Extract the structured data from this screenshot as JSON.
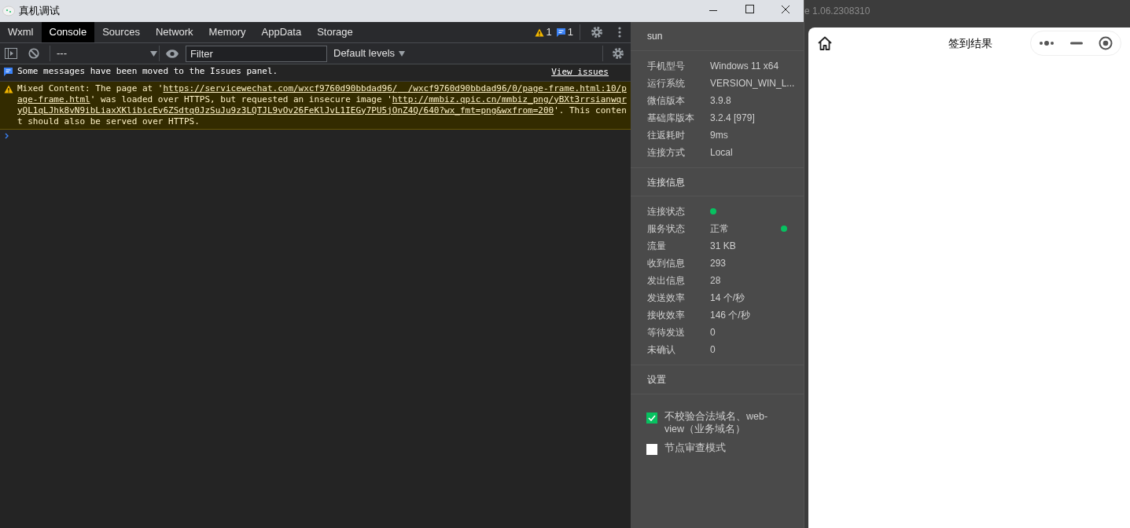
{
  "window": {
    "title": "真机调试"
  },
  "tabs": [
    {
      "label": "Wxml",
      "selected": false
    },
    {
      "label": "Console",
      "selected": true
    },
    {
      "label": "Sources",
      "selected": false
    },
    {
      "label": "Network",
      "selected": false
    },
    {
      "label": "Memory",
      "selected": false
    },
    {
      "label": "AppData",
      "selected": false
    },
    {
      "label": "Storage",
      "selected": false
    }
  ],
  "issue_counts": {
    "warnings": "1",
    "messages": "1"
  },
  "toolbar": {
    "context": "---",
    "filter_placeholder": "Filter",
    "levels": "Default levels"
  },
  "console": {
    "messages": [
      {
        "kind": "info",
        "parts": [
          {
            "text": "Some messages have been moved to the Issues panel.",
            "link": false
          }
        ],
        "action": "View issues"
      },
      {
        "kind": "warning",
        "parts": [
          {
            "text": "Mixed Content: The page at '",
            "link": false
          },
          {
            "text": "https://servicewechat.com/wxcf9760d90bbdad96/",
            "link": true
          },
          {
            "text": "  /wxcf9760d90bbdad96/0/page-frame.html:10/page-frame.html",
            "link": true
          },
          {
            "text": "' was loaded over HTTPS, but requested an insecure image '",
            "link": false
          },
          {
            "text": "http://mmbiz.qpic.cn/mmbiz_png/yBXt3rrsianwqryQL1qLJhk8vN9ibLiaxXKlibicEv6ZSdtq0JzSuJu9z3LQTJL9vOv26FeKlJvL1IEGy7PU5jOnZ4Q/640?wx_fmt=png&wxfrom=200",
            "link": true
          },
          {
            "text": "'. This content should also be served over HTTPS.",
            "link": false
          }
        ]
      }
    ]
  },
  "device_panel": {
    "user": "sun",
    "info": [
      {
        "label": "手机型号",
        "value": "Windows 11 x64"
      },
      {
        "label": "运行系统",
        "value": "VERSION_WIN_L..."
      },
      {
        "label": "微信版本",
        "value": "3.9.8"
      },
      {
        "label": "基础库版本",
        "value": "3.2.4 [979]"
      },
      {
        "label": "往返耗时",
        "value": "9ms"
      },
      {
        "label": "连接方式",
        "value": "Local"
      }
    ],
    "connection_title": "连接信息",
    "connection": [
      {
        "label": "连接状态",
        "color": "#07c160"
      },
      {
        "label": "服务状态",
        "value": "正常",
        "color": "#07c160"
      },
      {
        "label": "流量",
        "value": "31 KB"
      },
      {
        "label": "收到信息",
        "value": "293"
      },
      {
        "label": "发出信息",
        "value": "28"
      },
      {
        "label": "发送效率",
        "value": "14 个/秒"
      },
      {
        "label": "接收效率",
        "value": "146 个/秒"
      },
      {
        "label": "等待发送",
        "value": "0"
      },
      {
        "label": "未确认",
        "value": "0"
      }
    ],
    "settings_title": "设置",
    "options": [
      {
        "label": "不校验合法域名、web-view（业务域名）",
        "checked": true
      },
      {
        "label": "节点审查模式",
        "checked": false
      }
    ]
  },
  "background": {
    "version_text": "e 1.06.2308310"
  },
  "simulator": {
    "title": "签到结果"
  }
}
